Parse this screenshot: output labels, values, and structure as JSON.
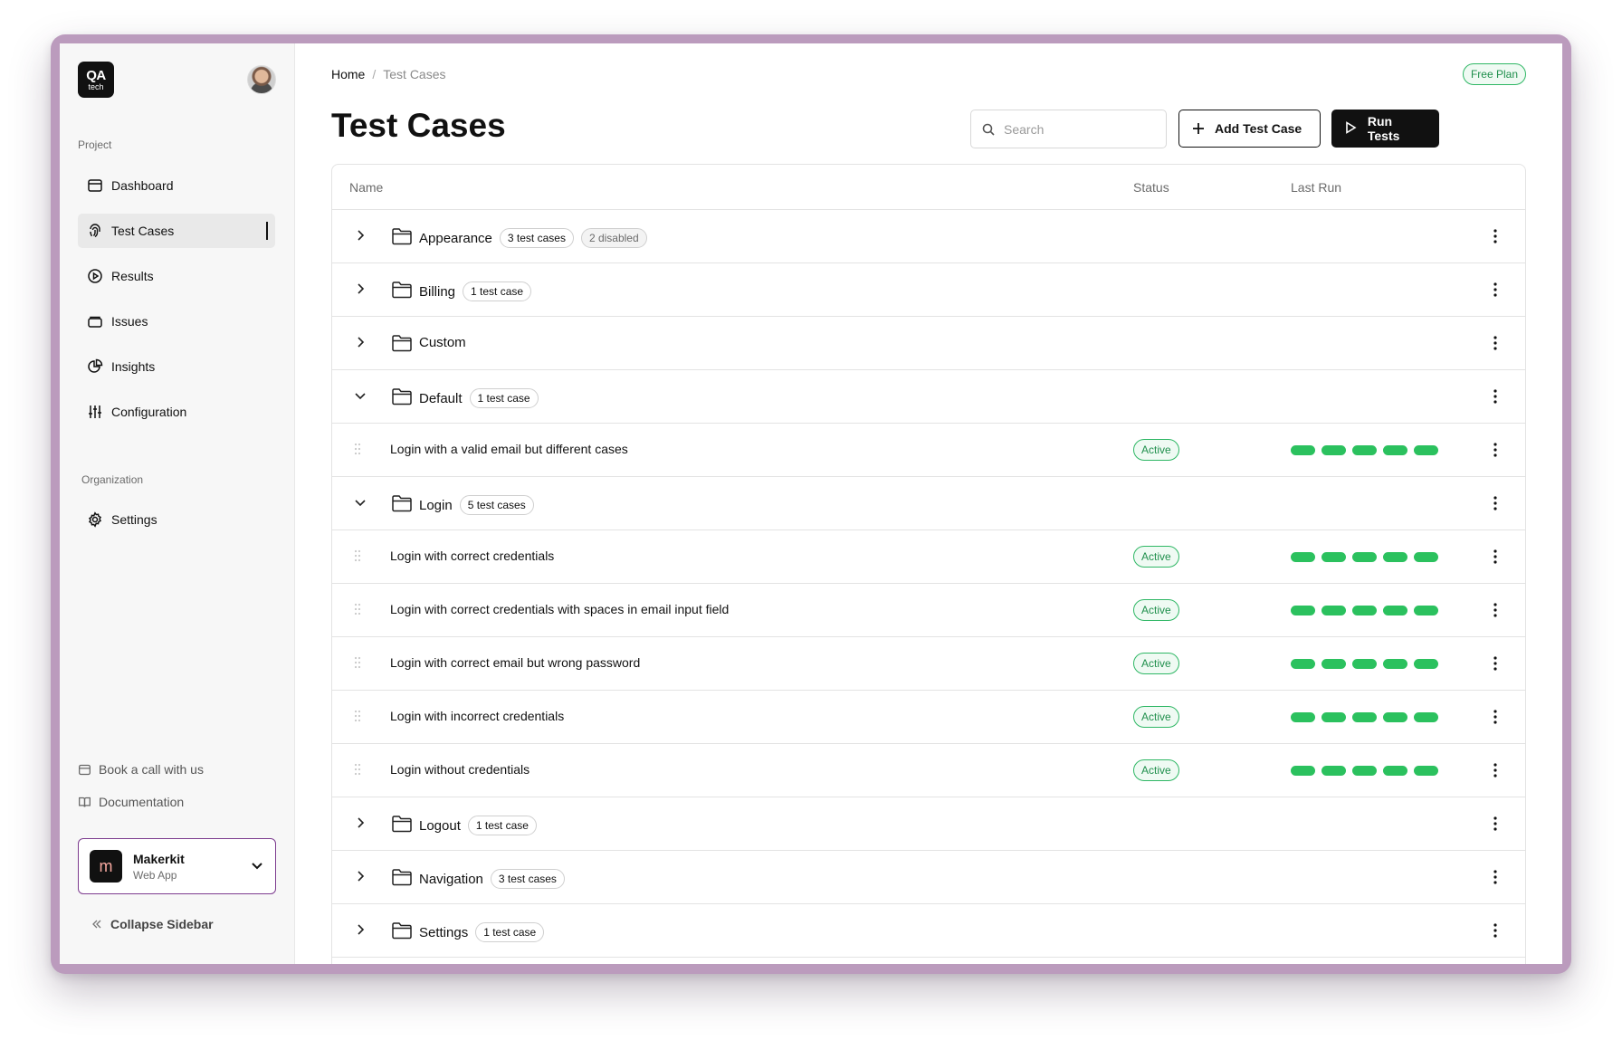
{
  "brand": {
    "logo_top": "QA",
    "logo_bottom": "tech"
  },
  "sidebar": {
    "project_label": "Project",
    "items": [
      {
        "label": "Dashboard",
        "icon": "calendar-icon"
      },
      {
        "label": "Test Cases",
        "icon": "fingerprint-icon",
        "active": true
      },
      {
        "label": "Results",
        "icon": "play-circle-icon"
      },
      {
        "label": "Issues",
        "icon": "stack-icon"
      },
      {
        "label": "Insights",
        "icon": "pie-chart-icon"
      },
      {
        "label": "Configuration",
        "icon": "sliders-icon"
      }
    ],
    "org_label": "Organization",
    "org_items": [
      {
        "label": "Settings",
        "icon": "gear-icon"
      }
    ],
    "footer_links": [
      {
        "label": "Book a call with us",
        "icon": "calendar-icon"
      },
      {
        "label": "Documentation",
        "icon": "book-icon"
      }
    ],
    "workspace": {
      "initial": "m",
      "name": "Makerkit",
      "subtitle": "Web App"
    },
    "collapse_label": "Collapse Sidebar"
  },
  "header": {
    "breadcrumb": {
      "home": "Home",
      "separator": "/",
      "current": "Test Cases"
    },
    "plan_badge": "Free Plan",
    "title": "Test Cases",
    "search_placeholder": "Search",
    "add_button": "Add Test Case",
    "run_button": "Run Tests"
  },
  "table": {
    "columns": [
      "Name",
      "Status",
      "Last Run"
    ],
    "rows": [
      {
        "type": "folder",
        "expanded": false,
        "name": "Appearance",
        "count": "3 test cases",
        "extra": "2 disabled"
      },
      {
        "type": "folder",
        "expanded": false,
        "name": "Billing",
        "count": "1 test case"
      },
      {
        "type": "folder",
        "expanded": false,
        "name": "Custom"
      },
      {
        "type": "folder",
        "expanded": true,
        "name": "Default",
        "count": "1 test case"
      },
      {
        "type": "case",
        "name": "Login with a valid email but different cases",
        "status": "Active",
        "runs": 5
      },
      {
        "type": "folder",
        "expanded": true,
        "name": "Login",
        "count": "5 test cases"
      },
      {
        "type": "case",
        "name": "Login with correct credentials",
        "status": "Active",
        "runs": 5
      },
      {
        "type": "case",
        "name": "Login with correct credentials with spaces in email input field",
        "status": "Active",
        "runs": 5
      },
      {
        "type": "case",
        "name": "Login with correct email but wrong password",
        "status": "Active",
        "runs": 5
      },
      {
        "type": "case",
        "name": "Login with incorrect credentials",
        "status": "Active",
        "runs": 5
      },
      {
        "type": "case",
        "name": "Login without credentials",
        "status": "Active",
        "runs": 5
      },
      {
        "type": "folder",
        "expanded": false,
        "name": "Logout",
        "count": "1 test case"
      },
      {
        "type": "folder",
        "expanded": false,
        "name": "Navigation",
        "count": "3 test cases"
      },
      {
        "type": "folder",
        "expanded": false,
        "name": "Settings",
        "count": "1 test case"
      }
    ]
  },
  "colors": {
    "accent_green": "#2bc15e",
    "frame": "#bb9bbd",
    "workspace_border": "#7d3c8f"
  }
}
